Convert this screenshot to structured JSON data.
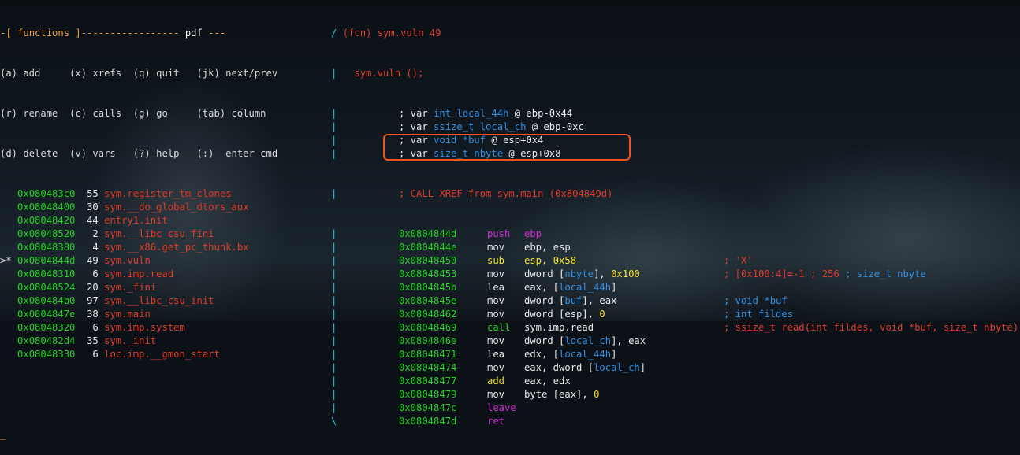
{
  "header": {
    "prefix": "-[ ",
    "title": "functions",
    "dashes": " ]----------------- ",
    "mode": "pdf",
    "suffix": " ---"
  },
  "help": [
    "(a) add     (x) xrefs  (q) quit   (jk) next/prev",
    "(r) rename  (c) calls  (g) go     (tab) column",
    "(d) delete  (v) vars   (?) help   (:)  enter cmd"
  ],
  "functions": [
    {
      "marker": "  ",
      "addr": "0x080483c0",
      "size": "55",
      "name": "sym.register_tm_clones"
    },
    {
      "marker": "  ",
      "addr": "0x08048400",
      "size": "30",
      "name": "sym.__do_global_dtors_aux"
    },
    {
      "marker": "  ",
      "addr": "0x08048420",
      "size": "44",
      "name": "entry1.init"
    },
    {
      "marker": "  ",
      "addr": "0x08048520",
      "size": " 2",
      "name": "sym.__libc_csu_fini"
    },
    {
      "marker": "  ",
      "addr": "0x08048380",
      "size": " 4",
      "name": "sym.__x86.get_pc_thunk.bx"
    },
    {
      "marker": ">*",
      "addr": "0x0804844d",
      "size": "49",
      "name": "sym.vuln"
    },
    {
      "marker": "  ",
      "addr": "0x08048310",
      "size": " 6",
      "name": "sym.imp.read"
    },
    {
      "marker": "  ",
      "addr": "0x08048524",
      "size": "20",
      "name": "sym._fini"
    },
    {
      "marker": "  ",
      "addr": "0x080484b0",
      "size": "97",
      "name": "sym.__libc_csu_init"
    },
    {
      "marker": "  ",
      "addr": "0x0804847e",
      "size": "38",
      "name": "sym.main"
    },
    {
      "marker": "  ",
      "addr": "0x08048320",
      "size": " 6",
      "name": "sym.imp.system"
    },
    {
      "marker": "  ",
      "addr": "0x080482d4",
      "size": "35",
      "name": "sym._init"
    },
    {
      "marker": "  ",
      "addr": "0x08048330",
      "size": " 6",
      "name": "loc.imp.__gmon_start"
    }
  ],
  "cursor": "_",
  "disasm": {
    "func_header": {
      "slash": "/ ",
      "sig": "(fcn) sym.vuln 49"
    },
    "func_proto": "sym.vuln ();",
    "vars": [
      {
        "prefix": "; var ",
        "type": "int",
        "name": "local_44h",
        "at": " @ ebp-0x44"
      },
      {
        "prefix": "; var ",
        "type": "ssize_t",
        "name": "local_ch",
        "at": " @ ebp-0xc"
      },
      {
        "prefix": "; var ",
        "type": "void",
        "name": "*buf",
        "at": " @ esp+0x4"
      },
      {
        "prefix": "; var ",
        "type": "size_t",
        "name": "nbyte",
        "at": " @ esp+0x8"
      }
    ],
    "xref": "; CALL XREF from sym.main (0x804849d)",
    "instructions": [
      {
        "addr": "0x0804844d",
        "mn": "push",
        "op": [
          [
            "ebp",
            "magenta"
          ]
        ],
        "cm": [],
        "mnc": "magenta"
      },
      {
        "addr": "0x0804844e",
        "mn": "mov",
        "op": [
          [
            "ebp, esp",
            "white"
          ]
        ],
        "cm": [],
        "mnc": "white"
      },
      {
        "addr": "0x08048450",
        "mn": "sub",
        "op": [
          [
            "esp, ",
            "yellow"
          ],
          [
            "0x58",
            "yellow"
          ]
        ],
        "cm": [
          [
            "; 'X'",
            "red"
          ]
        ],
        "mnc": "yellow"
      },
      {
        "addr": "0x08048453",
        "mn": "mov",
        "op": [
          [
            "dword [",
            "white"
          ],
          [
            "nbyte",
            "blue"
          ],
          [
            "], ",
            "white"
          ],
          [
            "0x100",
            "yellow"
          ]
        ],
        "cm": [
          [
            "; [0x100:4]=-1 ; 256 ",
            "red"
          ],
          [
            "; size_t nbyte",
            "blue"
          ]
        ],
        "mnc": "white"
      },
      {
        "addr": "0x0804845b",
        "mn": "lea",
        "op": [
          [
            "eax, [",
            "white"
          ],
          [
            "local_44h",
            "blue"
          ],
          [
            "]",
            "white"
          ]
        ],
        "cm": [],
        "mnc": "white"
      },
      {
        "addr": "0x0804845e",
        "mn": "mov",
        "op": [
          [
            "dword [",
            "white"
          ],
          [
            "buf",
            "blue"
          ],
          [
            "], eax",
            "white"
          ]
        ],
        "cm": [
          [
            "; void *buf",
            "blue"
          ]
        ],
        "mnc": "white"
      },
      {
        "addr": "0x08048462",
        "mn": "mov",
        "op": [
          [
            "dword [esp], ",
            "white"
          ],
          [
            "0",
            "yellow"
          ]
        ],
        "cm": [
          [
            "; int fildes",
            "blue"
          ]
        ],
        "mnc": "white"
      },
      {
        "addr": "0x08048469",
        "mn": "call",
        "op": [
          [
            "sym.imp.read",
            "white"
          ]
        ],
        "cm": [
          [
            "; ssize_t read(int fildes, void *buf, size_t nbyte)",
            "red"
          ]
        ],
        "mnc": "green"
      },
      {
        "addr": "0x0804846e",
        "mn": "mov",
        "op": [
          [
            "dword [",
            "white"
          ],
          [
            "local_ch",
            "blue"
          ],
          [
            "], eax",
            "white"
          ]
        ],
        "cm": [],
        "mnc": "white"
      },
      {
        "addr": "0x08048471",
        "mn": "lea",
        "op": [
          [
            "edx, [",
            "white"
          ],
          [
            "local_44h",
            "blue"
          ],
          [
            "]",
            "white"
          ]
        ],
        "cm": [],
        "mnc": "white"
      },
      {
        "addr": "0x08048474",
        "mn": "mov",
        "op": [
          [
            "eax, dword [",
            "white"
          ],
          [
            "local_ch",
            "blue"
          ],
          [
            "]",
            "white"
          ]
        ],
        "cm": [],
        "mnc": "white"
      },
      {
        "addr": "0x08048477",
        "mn": "add",
        "op": [
          [
            "eax, edx",
            "white"
          ]
        ],
        "cm": [],
        "mnc": "yellow"
      },
      {
        "addr": "0x08048479",
        "mn": "mov",
        "op": [
          [
            "byte [eax], ",
            "white"
          ],
          [
            "0",
            "yellow"
          ]
        ],
        "cm": [],
        "mnc": "white"
      },
      {
        "addr": "0x0804847c",
        "mn": "leave",
        "op": [],
        "cm": [],
        "mnc": "magenta"
      },
      {
        "addr": "0x0804847d",
        "mn": "ret",
        "op": [],
        "cm": [],
        "mnc": "magenta"
      }
    ]
  },
  "colors": {
    "address": "#1fd41f",
    "function_name": "#e03b2b",
    "pipe": "#2bc3e0",
    "highlight_box": "#f2541b"
  }
}
